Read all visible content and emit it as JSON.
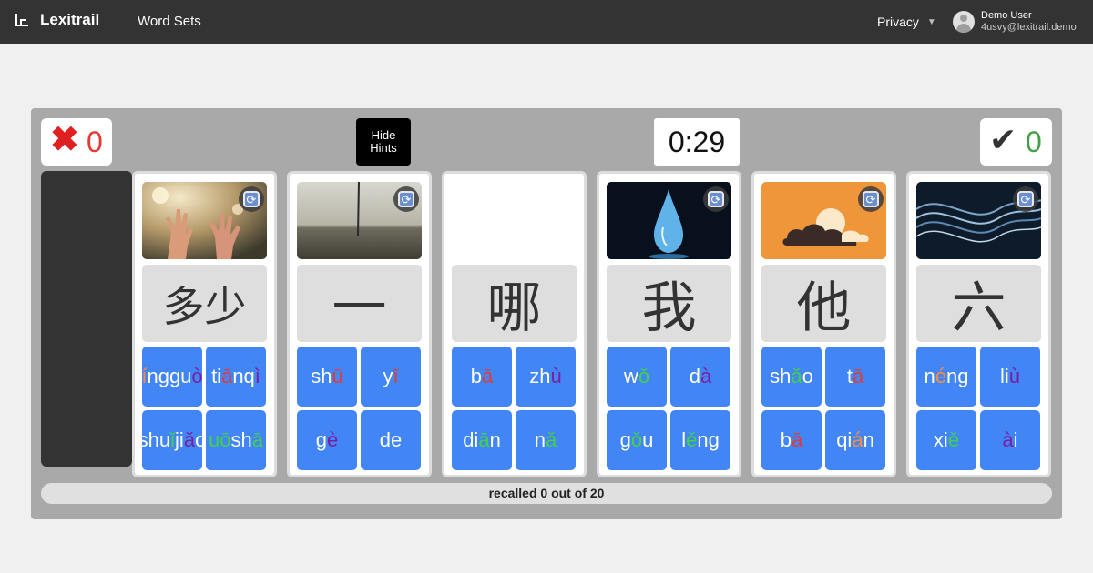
{
  "header": {
    "app_name": "Lexitrail",
    "nav_word_sets": "Word Sets",
    "privacy_label": "Privacy",
    "user_name": "Demo User",
    "user_email": "4usvy@lexitrail.demo"
  },
  "game": {
    "wrong_count": "0",
    "correct_count": "0",
    "hint_button": "Hide Hints",
    "timer": "0:29",
    "progress_text": "recalled 0 out of 20",
    "cards": [
      {
        "character": "多少",
        "image": "hands",
        "options": [
          [
            [
              "í",
              "t1"
            ],
            [
              "nggu",
              "tw"
            ],
            [
              "ò",
              "t3"
            ]
          ],
          [
            [
              "ti",
              "tw"
            ],
            [
              "ā",
              "t4"
            ],
            [
              "nq",
              "tw"
            ],
            [
              "ì",
              "t3"
            ]
          ],
          [
            [
              "shu",
              "tw"
            ],
            [
              "ǐ",
              "t2"
            ],
            [
              "ji",
              "tw"
            ],
            [
              "ǎ",
              "t3"
            ],
            [
              "o",
              "tw"
            ]
          ],
          [
            [
              "uō",
              "t2"
            ],
            [
              "sh",
              "tw"
            ],
            [
              "ā",
              "t2"
            ]
          ]
        ]
      },
      {
        "character": "一",
        "image": "horizon",
        "options": [
          [
            [
              "sh",
              "tw"
            ],
            [
              "ū",
              "t4"
            ]
          ],
          [
            [
              "y",
              "tw"
            ],
            [
              "ī",
              "t4"
            ]
          ],
          [
            [
              "g",
              "tw"
            ],
            [
              "è",
              "t3"
            ]
          ],
          [
            [
              "de",
              "tw"
            ]
          ]
        ]
      },
      {
        "character": "哪",
        "image": "none",
        "options": [
          [
            [
              "b",
              "tw"
            ],
            [
              "ā",
              "t4"
            ]
          ],
          [
            [
              "zh",
              "tw"
            ],
            [
              "ù",
              "t3"
            ]
          ],
          [
            [
              "di",
              "tw"
            ],
            [
              "ā",
              "t2"
            ],
            [
              "n",
              "tw"
            ]
          ],
          [
            [
              "n",
              "tw"
            ],
            [
              "ǎ",
              "t2"
            ]
          ]
        ]
      },
      {
        "character": "我",
        "image": "droplet",
        "options": [
          [
            [
              "w",
              "tw"
            ],
            [
              "ǒ",
              "t2"
            ]
          ],
          [
            [
              "d",
              "tw"
            ],
            [
              "à",
              "t3"
            ]
          ],
          [
            [
              "g",
              "tw"
            ],
            [
              "ǒ",
              "t2"
            ],
            [
              "u",
              "tw"
            ]
          ],
          [
            [
              "l",
              "tw"
            ],
            [
              "ě",
              "t2"
            ],
            [
              "ng",
              "tw"
            ]
          ]
        ]
      },
      {
        "character": "他",
        "image": "cloud",
        "options": [
          [
            [
              "sh",
              "tw"
            ],
            [
              "ǎ",
              "t2"
            ],
            [
              "o",
              "tw"
            ]
          ],
          [
            [
              "t",
              "tw"
            ],
            [
              "ā",
              "t4"
            ]
          ],
          [
            [
              "b",
              "tw"
            ],
            [
              "ā",
              "t4"
            ]
          ],
          [
            [
              "qi",
              "tw"
            ],
            [
              "á",
              "t1"
            ],
            [
              "n",
              "tw"
            ]
          ]
        ]
      },
      {
        "character": "六",
        "image": "waves",
        "options": [
          [
            [
              "n",
              "tw"
            ],
            [
              "é",
              "t1"
            ],
            [
              "ng",
              "tw"
            ]
          ],
          [
            [
              "li",
              "tw"
            ],
            [
              "ù",
              "t3"
            ]
          ],
          [
            [
              "xi",
              "tw"
            ],
            [
              "ě",
              "t2"
            ]
          ],
          [
            [
              "à",
              "t3"
            ],
            [
              "i",
              "tw"
            ]
          ]
        ]
      }
    ]
  },
  "colors": {
    "topbar": "#333333",
    "option_bg": "#4285f4",
    "wrong": "#e53935",
    "correct": "#43a047"
  }
}
